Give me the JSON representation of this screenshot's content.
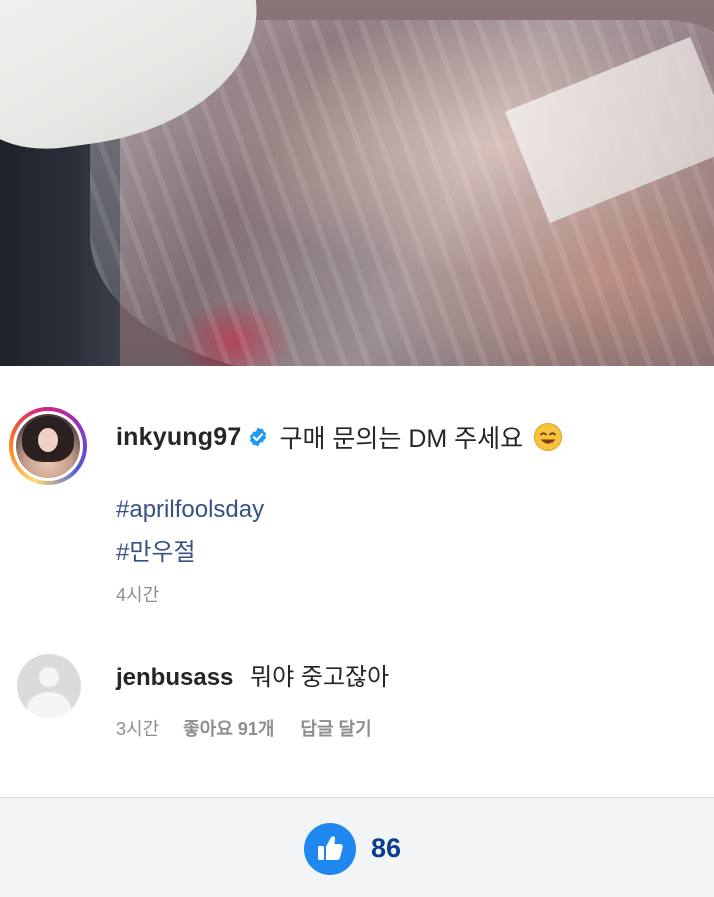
{
  "post": {
    "username": "inkyung97",
    "caption": "구매 문의는 DM 주세요",
    "hashtags": [
      "#aprilfoolsday",
      "#만우절"
    ],
    "time": "4시간"
  },
  "comment": {
    "username": "jenbusass",
    "text": "뭐야 중고잖아",
    "time": "3시간",
    "likes_label": "좋아요 91개",
    "reply_label": "답글 달기"
  },
  "footer": {
    "like_count": "86"
  },
  "colors": {
    "verified": "#1d9bf0",
    "hashtag": "#385185",
    "like_button": "#1e88f0",
    "like_count": "#0b3d91"
  },
  "icons": {
    "verified": "verified-badge-icon",
    "emoji": "smiling-face-emoji-icon",
    "like": "thumbs-up-icon",
    "default_avatar": "default-user-avatar-icon"
  }
}
